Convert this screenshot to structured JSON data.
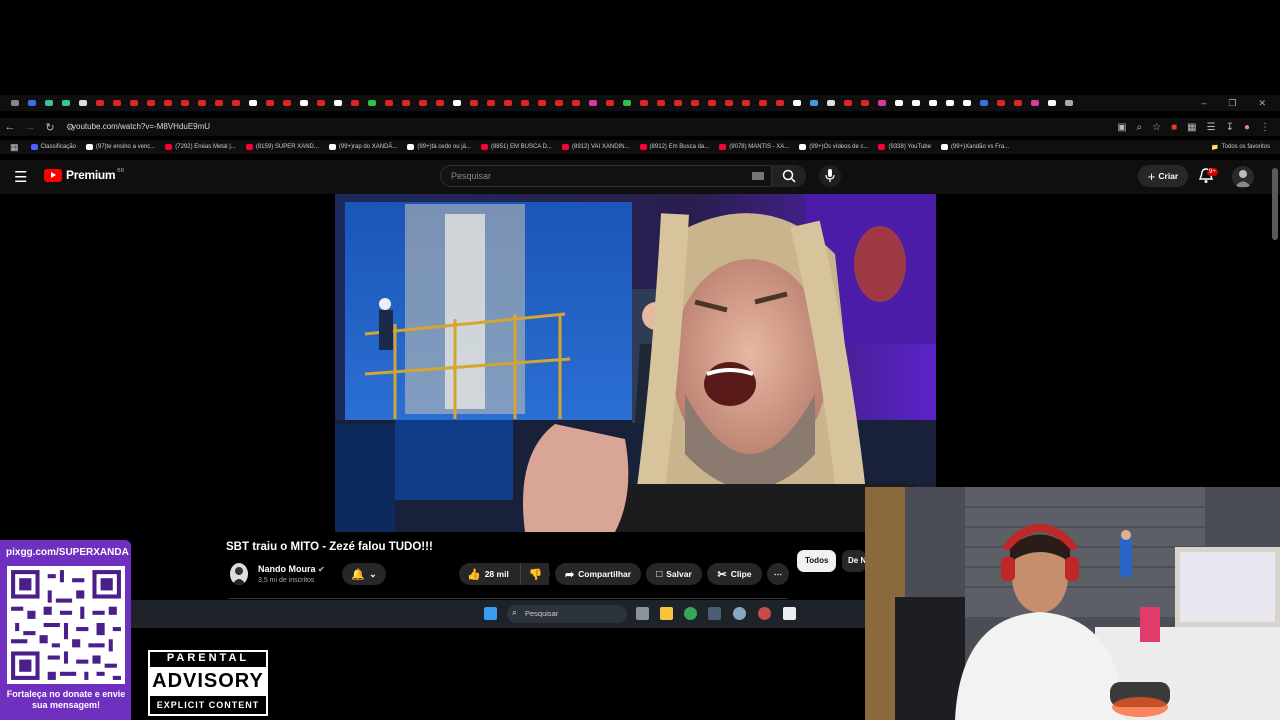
{
  "browser": {
    "url": "youtube.com/watch?v=-M8VHduE9mU",
    "bookmarks": [
      {
        "label": "Classificação",
        "color": "#4a63ff"
      },
      {
        "label": "(97)te ensino a venc...",
        "color": "#ffffff"
      },
      {
        "label": "(7292) Enéas Metal |...",
        "color": "#ff0033"
      },
      {
        "label": "(8159) SUPER XAND...",
        "color": "#ff0033"
      },
      {
        "label": "(99+)rap do XANDÃ...",
        "color": "#ffffff"
      },
      {
        "label": "(99+)tá cedo ou já...",
        "color": "#ffffff"
      },
      {
        "label": "(8851) EM BUSCA D...",
        "color": "#ff0033"
      },
      {
        "label": "(8912) VAI XANDIN...",
        "color": "#ff0033"
      },
      {
        "label": "(8912) Em Busca da...",
        "color": "#ff0033"
      },
      {
        "label": "(9078) MANTIS - XA...",
        "color": "#ff0033"
      },
      {
        "label": "(99+)Os vídeos de c...",
        "color": "#ffffff"
      },
      {
        "label": "(9338) YouTube",
        "color": "#ff0033"
      },
      {
        "label": "(99+)Xandão vs Fra...",
        "color": "#ffffff"
      }
    ],
    "all_bookmarks": "Todos os favoritos"
  },
  "youtube": {
    "logo": "Premium",
    "region": "BR",
    "search_placeholder": "Pesquisar",
    "create_label": "Criar",
    "notifications_badge": "9+"
  },
  "video": {
    "title": "SBT traiu o MITO - Zezé falou TUDO!!!",
    "channel": "Nando Moura",
    "subscribers": "3,5 mi de inscritos",
    "likes": "28 mil",
    "share_label": "Compartilhar",
    "save_label": "Salvar",
    "clip_label": "Clipe"
  },
  "chips": {
    "todos": "Todos",
    "de": "De N"
  },
  "taskbar": {
    "search_placeholder": "Pesquisar"
  },
  "overlay": {
    "qr_url": "pixgg.com/SUPERXANDA",
    "qr_caption": "Fortaleça no donate e envie sua mensagem!",
    "advisory_top": "PARENTAL",
    "advisory_mid": "ADVISORY",
    "advisory_bottom": "EXPLICIT CONTENT"
  }
}
